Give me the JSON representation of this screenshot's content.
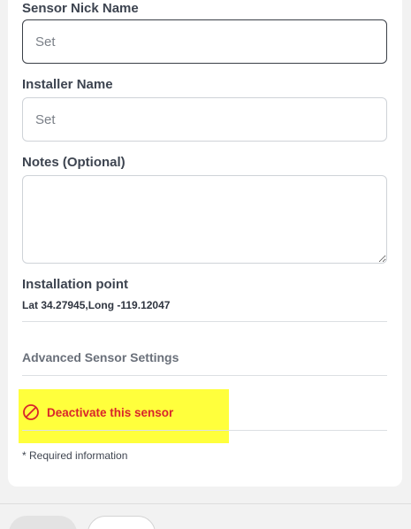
{
  "form": {
    "nick_name": {
      "label": "Sensor Nick Name",
      "placeholder": "Set",
      "value": ""
    },
    "installer_name": {
      "label": "Installer Name",
      "placeholder": "Set",
      "value": ""
    },
    "notes": {
      "label": "Notes (Optional)",
      "value": ""
    },
    "installation_point": {
      "label": "Installation point",
      "coordinates": "Lat 34.27945,Long -119.12047"
    },
    "advanced_settings_label": "Advanced Sensor Settings",
    "deactivate_label": "Deactivate this sensor",
    "required_note": "* Required information"
  },
  "icons": {
    "deactivate": "prohibited-circle-icon"
  },
  "colors": {
    "danger": "#d9252b",
    "highlight": "#ffff3c",
    "focused_border": "#3a3f47"
  }
}
